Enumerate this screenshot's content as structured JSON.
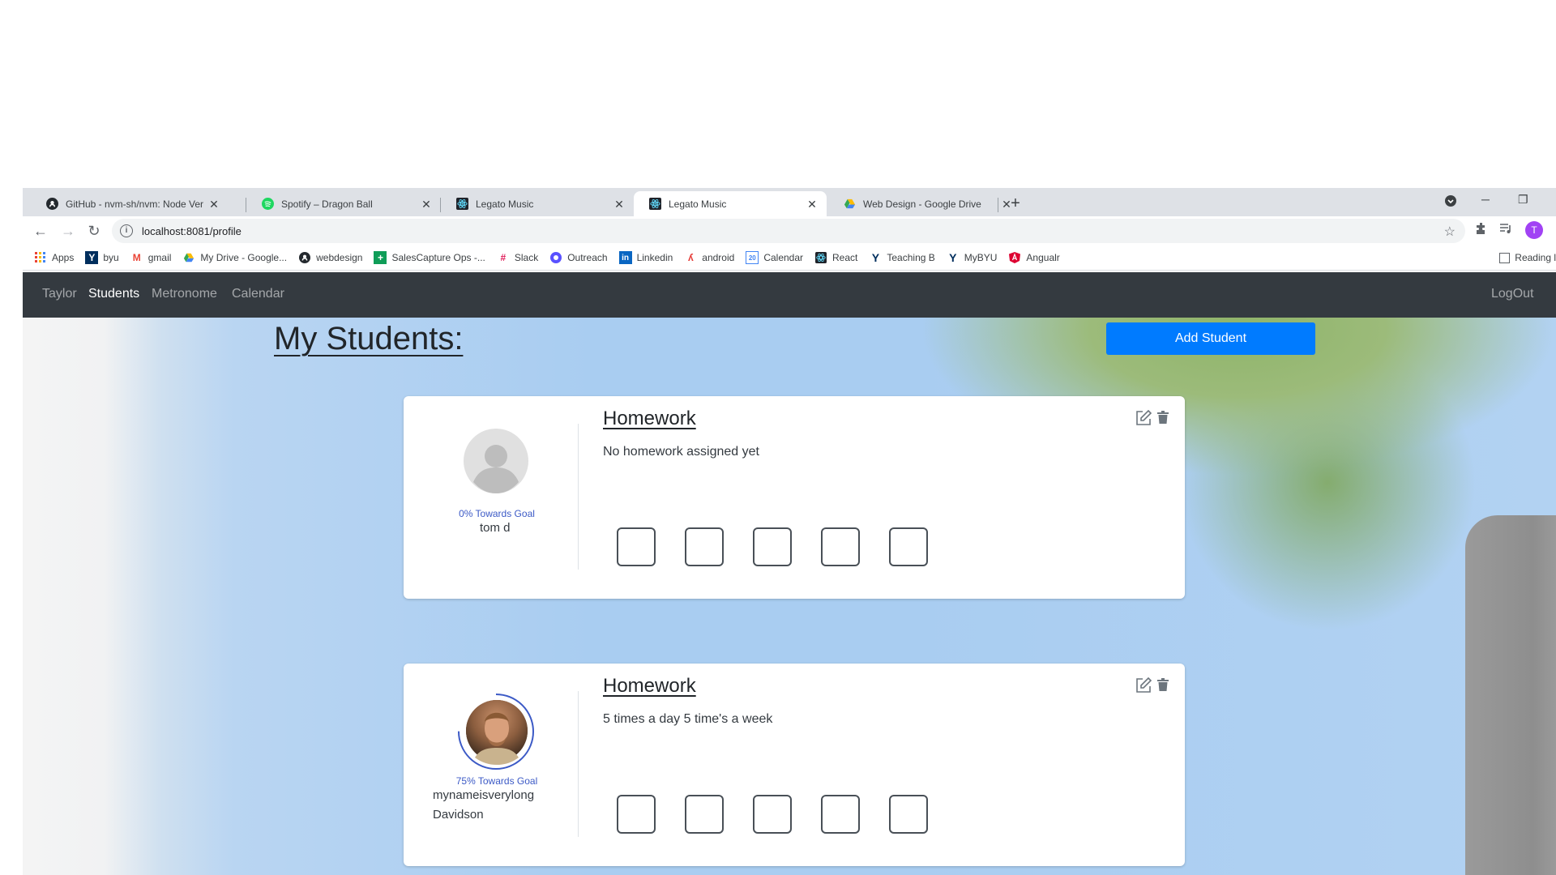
{
  "browser": {
    "tabs": [
      {
        "label": "GitHub - nvm-sh/nvm: Node Ver",
        "icon": "github-icon",
        "active": false
      },
      {
        "label": "Spotify – Dragon Ball",
        "icon": "spotify-icon",
        "active": false
      },
      {
        "label": "Legato Music",
        "icon": "react-icon",
        "active": false
      },
      {
        "label": "Legato Music",
        "icon": "react-icon",
        "active": true
      },
      {
        "label": "Web Design - Google Drive",
        "icon": "google-drive-icon",
        "active": false
      }
    ],
    "address": "localhost:8081/profile",
    "profile_initial": "T",
    "bookmarks": [
      {
        "label": "Apps",
        "icon": "apps-grid-icon"
      },
      {
        "label": "byu",
        "icon": "byu-icon"
      },
      {
        "label": "gmail",
        "icon": "gmail-icon"
      },
      {
        "label": "My Drive - Google...",
        "icon": "google-drive-icon"
      },
      {
        "label": "webdesign",
        "icon": "github-icon"
      },
      {
        "label": "SalesCapture Ops -...",
        "icon": "sheets-icon"
      },
      {
        "label": "Slack",
        "icon": "slack-icon"
      },
      {
        "label": "Outreach",
        "icon": "outreach-icon"
      },
      {
        "label": "Linkedin",
        "icon": "linkedin-icon"
      },
      {
        "label": "android",
        "icon": "android-icon"
      },
      {
        "label": "Calendar",
        "icon": "calendar-icon"
      },
      {
        "label": "React",
        "icon": "react-icon"
      },
      {
        "label": "Teaching B",
        "icon": "byu-icon"
      },
      {
        "label": "MyBYU",
        "icon": "byu-icon"
      },
      {
        "label": "Angualr",
        "icon": "angular-icon"
      }
    ],
    "reading_list": "Reading l"
  },
  "navbar": {
    "brand": "Taylor",
    "links": [
      "Students",
      "Metronome",
      "Calendar"
    ],
    "logout": "LogOut"
  },
  "page": {
    "title": "My Students:",
    "add_button": "Add Student"
  },
  "students": [
    {
      "name_line1": "tom d",
      "name_line2": "",
      "goal": "0% Towards Goal",
      "goal_progress": 0,
      "avatar": "default-avatar",
      "homework_title": "Homework",
      "homework_text": "No homework assigned yet",
      "checkbox_count": 5
    },
    {
      "name_line1": "mynameisverylong",
      "name_line2": "Davidson",
      "goal": "75% Towards Goal",
      "goal_progress": 0.75,
      "avatar": "photo-avatar",
      "homework_title": "Homework",
      "homework_text": "5 times a day 5 time's a week",
      "checkbox_count": 5
    }
  ],
  "colors": {
    "navbar": "#343a40",
    "primary": "#007bff",
    "goal_ring": "#3c5ac6",
    "profile": "#a142f4"
  }
}
